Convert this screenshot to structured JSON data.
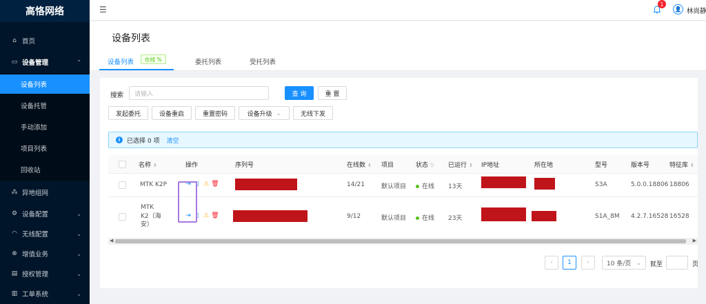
{
  "app": {
    "brand": "高恪网络"
  },
  "sidebar": {
    "items": [
      {
        "label": "首页",
        "icon": "home-icon"
      },
      {
        "label": "设备管理",
        "icon": "desktop-icon"
      },
      {
        "label": "异地组网",
        "icon": "network-icon"
      },
      {
        "label": "设备配置",
        "icon": "gear-icon"
      },
      {
        "label": "无线配置",
        "icon": "wifi-icon"
      },
      {
        "label": "增值业务",
        "icon": "plus-circle-icon"
      },
      {
        "label": "授权管理",
        "icon": "id-card-icon"
      },
      {
        "label": "工单系统",
        "icon": "ticket-icon"
      }
    ],
    "sub_items": [
      {
        "label": "设备列表"
      },
      {
        "label": "设备托管"
      },
      {
        "label": "手动添加"
      },
      {
        "label": "项目列表"
      },
      {
        "label": "回收站"
      }
    ]
  },
  "header": {
    "notification_count": "1",
    "username": "林尚静"
  },
  "page": {
    "title": "设备列表",
    "tabs": [
      {
        "label": "设备列表",
        "tag": "在线 %"
      },
      {
        "label": "委托列表"
      },
      {
        "label": "受托列表"
      }
    ]
  },
  "search": {
    "label": "搜索",
    "placeholder": "请输入",
    "query_label": "查 询",
    "reset_label": "重 置"
  },
  "actions": {
    "delegate": "发起委托",
    "restart": "设备重启",
    "reset_password": "重置密码",
    "upgrade": "设备升级",
    "wireless_push": "无线下发"
  },
  "selection": {
    "text": "已选择 0 项",
    "clear": "清空"
  },
  "table": {
    "columns": {
      "name": "名称",
      "ops": "操作",
      "serial": "序列号",
      "online": "在线数",
      "project": "项目",
      "status": "状态",
      "uptime": "已运行",
      "ip": "IP地址",
      "location": "所在地",
      "model": "型号",
      "version": "版本号",
      "feature": "特征库"
    },
    "rows": [
      {
        "name": "MTK K2P",
        "online": "14/21",
        "project": "默认项目",
        "status": "在线",
        "uptime": "13天",
        "model": "S3A",
        "version": "5.0.0.18806",
        "feature": "18806"
      },
      {
        "name_lines": [
          "MTK",
          "K2（海",
          "安）"
        ],
        "online": "9/12",
        "project": "默认项目",
        "status": "在线",
        "uptime": "23天",
        "model": "S1A_8M",
        "version": "4.2.7.16528",
        "feature": "16528"
      }
    ]
  },
  "pagination": {
    "current": "1",
    "page_size": "10 条/页",
    "goto_label": "就至",
    "page_suffix": "页"
  },
  "colors": {
    "accent": "#1890ff",
    "sidebar_bg": "#001529",
    "redaction": "#c0141b",
    "highlight": "#a678e0",
    "online": "#52c41a"
  }
}
